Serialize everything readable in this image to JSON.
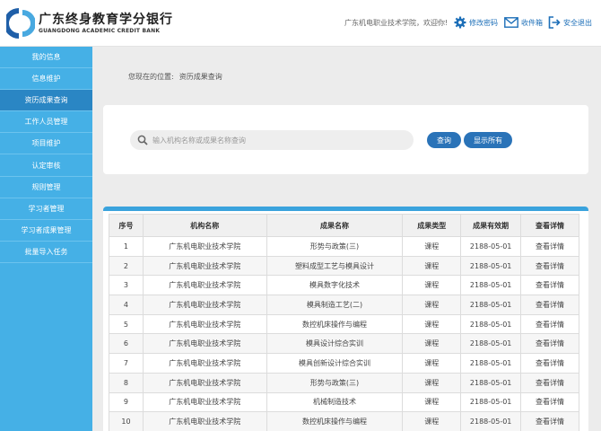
{
  "header": {
    "brand_cn": "广东终身教育学分银行",
    "brand_en": "GUANGDONG ACADEMIC CREDIT BANK",
    "welcome": "广东机电职业技术学院，欢迎你!",
    "change_password": "修改密码",
    "inbox": "收件箱",
    "logout": "安全退出",
    "accent_color": "#1d6fb8"
  },
  "sidebar": {
    "color": "#45b0e6",
    "active_color": "#2a86c4",
    "items": [
      {
        "label": "我的信息"
      },
      {
        "label": "信息维护"
      },
      {
        "label": "资历成果查询"
      },
      {
        "label": "工作人员管理"
      },
      {
        "label": "项目维护"
      },
      {
        "label": "认定审核"
      },
      {
        "label": "规则管理"
      },
      {
        "label": "学习者管理"
      },
      {
        "label": "学习者成果管理"
      },
      {
        "label": "批量导入任务"
      }
    ],
    "active_index": 2
  },
  "breadcrumb": {
    "prefix": "您现在的位置:",
    "current": "资历成果查询"
  },
  "search": {
    "placeholder": "输入机构名称或成果名称查询",
    "value": "",
    "query_label": "查询",
    "show_all_label": "显示所有"
  },
  "table": {
    "columns": [
      "序号",
      "机构名称",
      "成果名称",
      "成果类型",
      "成果有效期",
      "查看详情"
    ],
    "rows": [
      {
        "no": "1",
        "org": "广东机电职业技术学院",
        "name": "形势与政策(三)",
        "type": "课程",
        "valid": "2188-05-01",
        "detail": "查看详情"
      },
      {
        "no": "2",
        "org": "广东机电职业技术学院",
        "name": "塑料成型工艺与模具设计",
        "type": "课程",
        "valid": "2188-05-01",
        "detail": "查看详情"
      },
      {
        "no": "3",
        "org": "广东机电职业技术学院",
        "name": "模具数字化技术",
        "type": "课程",
        "valid": "2188-05-01",
        "detail": "查看详情"
      },
      {
        "no": "4",
        "org": "广东机电职业技术学院",
        "name": "模具制造工艺(二)",
        "type": "课程",
        "valid": "2188-05-01",
        "detail": "查看详情"
      },
      {
        "no": "5",
        "org": "广东机电职业技术学院",
        "name": "数控机床操作与编程",
        "type": "课程",
        "valid": "2188-05-01",
        "detail": "查看详情"
      },
      {
        "no": "6",
        "org": "广东机电职业技术学院",
        "name": "模具设计综合实训",
        "type": "课程",
        "valid": "2188-05-01",
        "detail": "查看详情"
      },
      {
        "no": "7",
        "org": "广东机电职业技术学院",
        "name": "模具创新设计综合实训",
        "type": "课程",
        "valid": "2188-05-01",
        "detail": "查看详情"
      },
      {
        "no": "8",
        "org": "广东机电职业技术学院",
        "name": "形势与政策(三)",
        "type": "课程",
        "valid": "2188-05-01",
        "detail": "查看详情"
      },
      {
        "no": "9",
        "org": "广东机电职业技术学院",
        "name": "机械制造技术",
        "type": "课程",
        "valid": "2188-05-01",
        "detail": "查看详情"
      },
      {
        "no": "10",
        "org": "广东机电职业技术学院",
        "name": "数控机床操作与编程",
        "type": "课程",
        "valid": "2188-05-01",
        "detail": "查看详情"
      }
    ]
  }
}
